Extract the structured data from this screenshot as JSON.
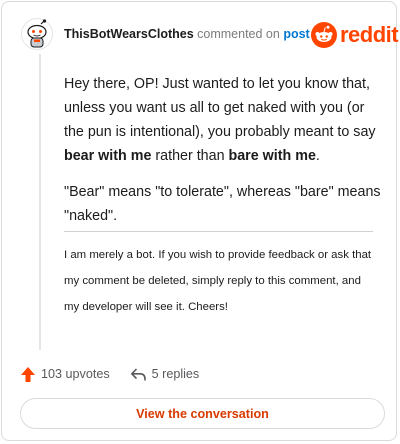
{
  "comment": {
    "author": "ThisBotWearsClothes",
    "action_text": "commented on",
    "target_link": "post",
    "body": {
      "p1_prefix": "Hey there, OP! Just wanted to let you know that, unless you want us all to get naked with you (or the pun is intentional), you probably meant to say ",
      "p1_bold1": "bear with me",
      "p1_middle": " rather than ",
      "p1_bold2": "bare with me",
      "p1_suffix": ".",
      "p2": "\"Bear\" means \"to tolerate\", whereas \"bare\" means \"naked\"."
    },
    "bot_note": "I am merely a bot. If you wish to provide feedback or ask that my comment be deleted, simply reply to this comment, and my developer will see it. Cheers!"
  },
  "brand": {
    "logo_text": "reddit",
    "accent": "#ff4500"
  },
  "stats": {
    "upvotes": "103 upvotes",
    "replies": "5 replies"
  },
  "cta": {
    "label": "View the conversation"
  },
  "icons": {
    "avatar": "snoo-avatar-icon",
    "logo": "reddit-logo-icon",
    "upvote": "upvote-arrow-icon",
    "reply": "reply-arrow-icon"
  }
}
